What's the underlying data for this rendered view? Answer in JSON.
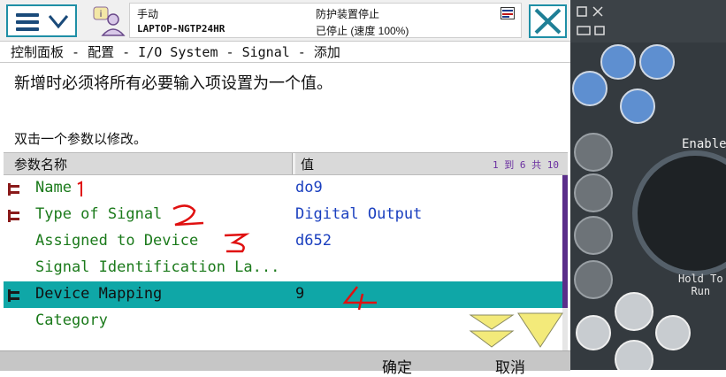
{
  "status": {
    "mode": "手动",
    "controller": "LAPTOP-NGTP24HR",
    "safety_state": "防护装置停止",
    "run_state": "已停止 (速度 100%)"
  },
  "breadcrumb": "控制面板 - 配置 - I/O System - Signal - 添加",
  "info": {
    "line1": "新增时必须将所有必要输入项设置为一个值。",
    "line2": "双击一个参数以修改。"
  },
  "table": {
    "col_name": "参数名称",
    "col_value": "值",
    "count": "1 到 6 共 10",
    "rows": [
      {
        "name": "Name",
        "value": "do9"
      },
      {
        "name": "Type of Signal",
        "value": "Digital Output"
      },
      {
        "name": "Assigned to Device",
        "value": "d652"
      },
      {
        "name": "Signal Identification La...",
        "value": ""
      },
      {
        "name": "Device Mapping",
        "value": "9"
      },
      {
        "name": "Category",
        "value": ""
      }
    ]
  },
  "buttons": {
    "ok": "确定",
    "cancel": "取消"
  },
  "hardware": {
    "enable_label": "Enable",
    "hold_run_line1": "Hold To",
    "hold_run_line2": "Run"
  },
  "colors": {
    "accent_teal": "#0fa7a7",
    "name_green": "#1b7a1b",
    "value_blue": "#1a3fbf",
    "annotation_red": "#e01010"
  },
  "icons": [
    "menu-icon",
    "user-icon",
    "status-icon",
    "close-icon",
    "row-param-icon",
    "scroll-down-icon",
    "page-down-icon"
  ]
}
